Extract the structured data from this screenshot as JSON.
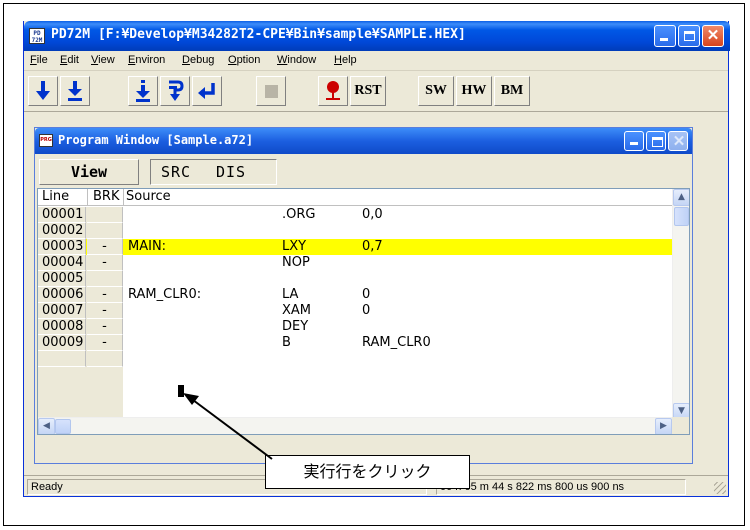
{
  "app": {
    "icon_text": "PD72M",
    "title": "PD72M [F:¥Develop¥M34282T2-CPE¥Bin¥sample¥SAMPLE.HEX]",
    "menu": [
      {
        "label": "File",
        "u": "F",
        "rest": "ile"
      },
      {
        "label": "Edit",
        "u": "E",
        "rest": "dit"
      },
      {
        "label": "View",
        "u": "V",
        "rest": "iew"
      },
      {
        "label": "Environ",
        "u": "E",
        "rest": "nviron"
      },
      {
        "label": "Debug",
        "u": "D",
        "rest": "ebug"
      },
      {
        "label": "Option",
        "u": "O",
        "rest": "ption"
      },
      {
        "label": "Window",
        "u": "W",
        "rest": "indow"
      },
      {
        "label": "Help",
        "u": "H",
        "rest": "elp"
      }
    ],
    "toolbar": {
      "rst": "RST",
      "sw": "SW",
      "hw": "HW",
      "bm": "BM"
    }
  },
  "program_window": {
    "icon_text": "PRG",
    "title": "Program Window [Sample.a72]",
    "view_button": "View",
    "src_tab": "SRC",
    "dis_tab": "DIS",
    "columns": {
      "line": "Line",
      "brk": "BRK",
      "source": "Source"
    },
    "rows": [
      {
        "line": "00001",
        "brk": "",
        "label": "",
        "op": ".ORG",
        "arg": "0,0",
        "highlight": false
      },
      {
        "line": "00002",
        "brk": "",
        "label": "",
        "op": "",
        "arg": "",
        "highlight": false
      },
      {
        "line": "00003",
        "brk": "-",
        "label": "MAIN:",
        "op": "LXY",
        "arg": "0,7",
        "highlight": true
      },
      {
        "line": "00004",
        "brk": "-",
        "label": "",
        "op": "NOP",
        "arg": "",
        "highlight": false
      },
      {
        "line": "00005",
        "brk": "",
        "label": "",
        "op": "",
        "arg": "",
        "highlight": false
      },
      {
        "line": "00006",
        "brk": "-",
        "label": "RAM_CLR0:",
        "op": "LA",
        "arg": "0",
        "highlight": false
      },
      {
        "line": "00007",
        "brk": "-",
        "label": "",
        "op": "XAM",
        "arg": "0",
        "highlight": false
      },
      {
        "line": "00008",
        "brk": "-",
        "label": "",
        "op": "DEY",
        "arg": "",
        "highlight": false
      },
      {
        "line": "00009",
        "brk": "-",
        "label": "",
        "op": "B",
        "arg": "RAM_CLR0",
        "highlight": false
      }
    ]
  },
  "status": {
    "ready": "Ready",
    "time": "00 h 05 m 44 s 822 ms 800 us 900 ns"
  },
  "annotation": {
    "callout": "実行行をクリック"
  },
  "colors": {
    "highlight_row": "#ffff00",
    "title_blue": "#0058e6",
    "toolbar_arrow_blue": "#0033cc",
    "stop_red": "#cc0000"
  }
}
